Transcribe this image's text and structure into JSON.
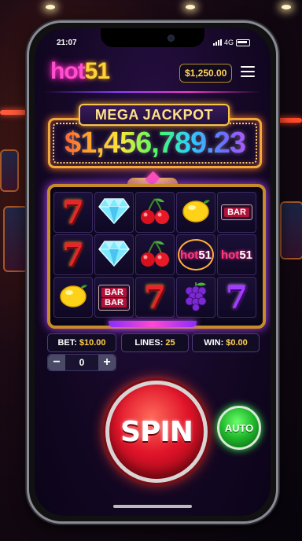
{
  "status": {
    "time": "21:07",
    "network": "4G"
  },
  "header": {
    "logo_text": "hot",
    "logo_num": "51",
    "balance": "$1,250.00"
  },
  "jackpot": {
    "label": "MEGA JACKPOT",
    "value": "$1,456,789.23"
  },
  "reels": {
    "rows": [
      [
        "seven",
        "diamond",
        "cherry",
        "lemon",
        "bar"
      ],
      [
        "seven",
        "diamond",
        "cherry",
        "hot51",
        "hot51"
      ],
      [
        "lemon",
        "double-bar",
        "seven",
        "grape",
        "purple-seven"
      ]
    ],
    "bar_text": "BAR",
    "hot_text": "hot",
    "hot_num": "51"
  },
  "info": {
    "bet_label": "BET:",
    "bet_value": "$10.00",
    "lines_label": "LINES:",
    "lines_value": "25",
    "win_label": "WIN:",
    "win_value": "$0.00"
  },
  "stepper": {
    "minus": "−",
    "value": "0",
    "plus": "+"
  },
  "buttons": {
    "spin": "SPIN",
    "auto": "AUTO"
  },
  "colors": {
    "accent_pink": "#ff4fd0",
    "gold": "#ffd24a",
    "spin_red": "#e0142a",
    "auto_green": "#1fb62a"
  }
}
